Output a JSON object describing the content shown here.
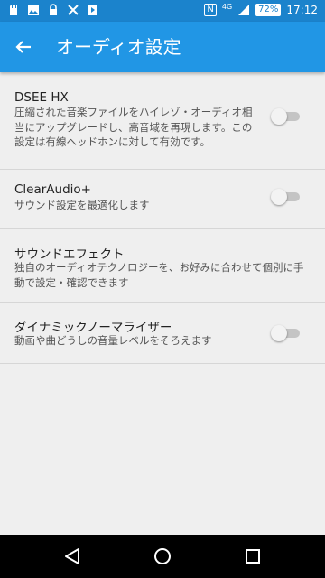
{
  "status_bar": {
    "network_label": "4G",
    "battery": "72%",
    "time": "17:12",
    "nfc_label": "N",
    "left_icons": [
      "sd-card-icon",
      "image-icon",
      "lock-icon",
      "tools-icon",
      "sony-select-icon"
    ]
  },
  "header": {
    "title": "オーディオ設定",
    "back_icon": "arrow-left-icon"
  },
  "settings": [
    {
      "title": "DSEE HX",
      "description": "圧縮された音楽ファイルをハイレゾ・オーディオ相当にアップグレードし、高音域を再現します。この設定は有線ヘッドホンに対して有効です。",
      "toggle": false
    },
    {
      "title": "ClearAudio+",
      "description": "サウンド設定を最適化します",
      "toggle": false
    },
    {
      "title": "サウンドエフェクト",
      "description": "独自のオーディオテクノロジーを、お好みに合わせて個別に手動で設定・確認できます"
    },
    {
      "title": "ダイナミックノーマライザー",
      "description": "動画や曲どうしの音量レベルをそろえます",
      "toggle": false
    }
  ],
  "nav": {
    "back_icon": "triangle-back-icon",
    "home_icon": "circle-home-icon",
    "recents_icon": "square-recents-icon"
  },
  "colors": {
    "status_bar": "#1b83cc",
    "app_bar": "#2196e5",
    "background": "#efefef",
    "toggle_off_track": "#c4c4c4"
  }
}
